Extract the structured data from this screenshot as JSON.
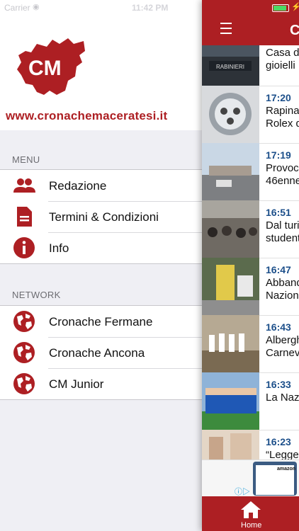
{
  "status_bar": {
    "carrier": "Carrier",
    "time": "11:42 PM"
  },
  "brand": {
    "logo_text": "CM",
    "site_url": "www.cronachemaceratesi.it"
  },
  "menu_section": {
    "title": "MENU",
    "items": [
      {
        "label": "Redazione",
        "icon": "people-icon"
      },
      {
        "label": "Termini & Condizioni",
        "icon": "document-icon"
      },
      {
        "label": "Info",
        "icon": "info-icon"
      }
    ]
  },
  "network_section": {
    "title": "NETWORK",
    "items": [
      {
        "label": "Cronache Fermane",
        "icon": "globe-icon"
      },
      {
        "label": "Cronache Ancona",
        "icon": "globe-icon"
      },
      {
        "label": "CM Junior",
        "icon": "globe-icon"
      }
    ]
  },
  "app": {
    "title": "C",
    "accent": "#ad1f23",
    "news": [
      {
        "time": "",
        "title": "Casa d\ngioielli"
      },
      {
        "time": "17:20",
        "title": "Rapina\nRolex d"
      },
      {
        "time": "17:19",
        "title": "Provoc\n46enne"
      },
      {
        "time": "16:51",
        "title": "Dal turi\nstudent"
      },
      {
        "time": "16:47",
        "title": "Abband\nNazion"
      },
      {
        "time": "16:43",
        "title": "Albergh\nCarnev"
      },
      {
        "time": "16:33",
        "title": "La Naz"
      },
      {
        "time": "16:23",
        "title": "“Legge"
      }
    ],
    "ad": {
      "brand": "amazon"
    },
    "tab": {
      "label": "Home"
    }
  }
}
